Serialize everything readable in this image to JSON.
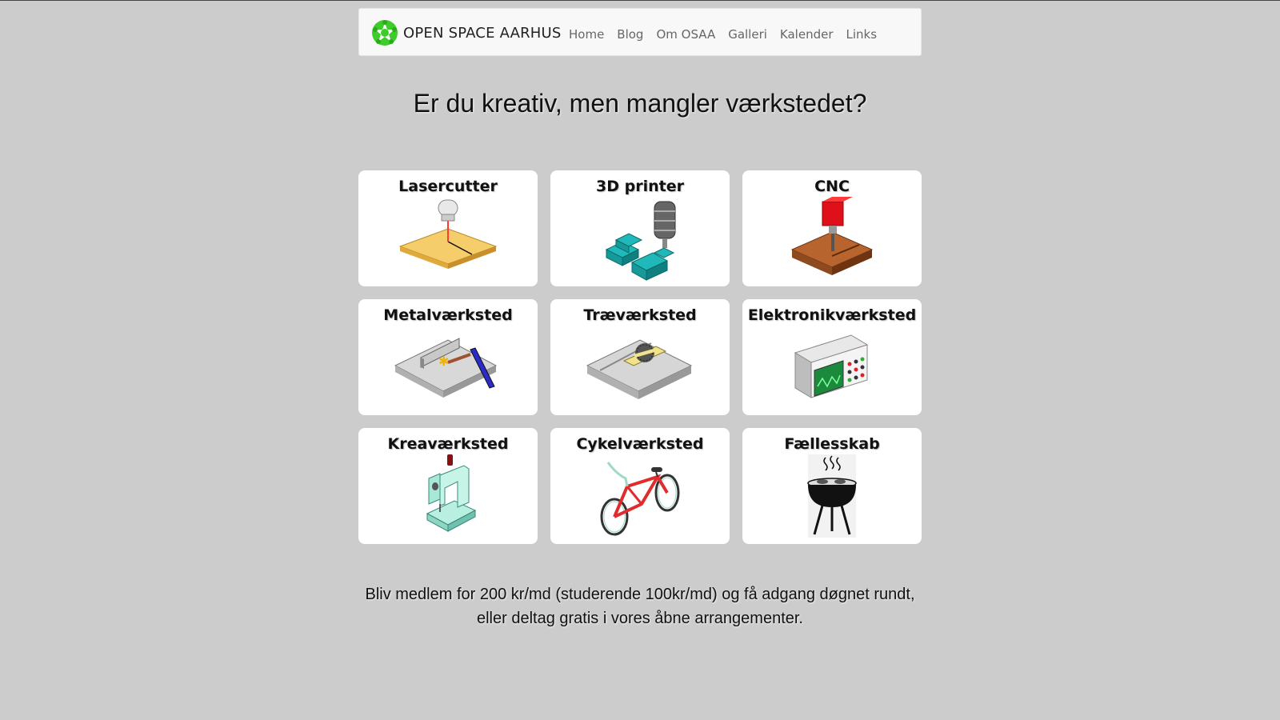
{
  "brand": {
    "name": "OPEN SPACE AARHUS",
    "logo_icon": "osaa-green-star-logo-icon"
  },
  "nav": {
    "items": [
      {
        "label": "Home"
      },
      {
        "label": "Blog"
      },
      {
        "label": "Om OSAA"
      },
      {
        "label": "Galleri"
      },
      {
        "label": "Kalender"
      },
      {
        "label": "Links"
      }
    ]
  },
  "headline": "Er du kreativ, men mangler værkstedet?",
  "workshops": [
    {
      "title": "Lasercutter",
      "icon": "lasercutter-icon"
    },
    {
      "title": "3D printer",
      "icon": "3d-printer-icon"
    },
    {
      "title": "CNC",
      "icon": "cnc-icon"
    },
    {
      "title": "Metalværksted",
      "icon": "metal-workshop-icon"
    },
    {
      "title": "Træværksted",
      "icon": "wood-workshop-icon"
    },
    {
      "title": "Elektronikværksted",
      "icon": "electronics-workshop-icon"
    },
    {
      "title": "Kreaværksted",
      "icon": "sewing-machine-icon"
    },
    {
      "title": "Cykelværksted",
      "icon": "bicycle-icon"
    },
    {
      "title": "Fællesskab",
      "icon": "grill-icon"
    }
  ],
  "membership": {
    "line1": "Bliv medlem for 200 kr/md (studerende 100kr/md) og få adgang døgnet rundt,",
    "line2": "eller deltag gratis i vores åbne arrangementer."
  },
  "colors": {
    "background": "#cccccc",
    "navbar": "#f8f8f8",
    "logo_green": "#3dcc2a",
    "nav_link": "#666666"
  }
}
